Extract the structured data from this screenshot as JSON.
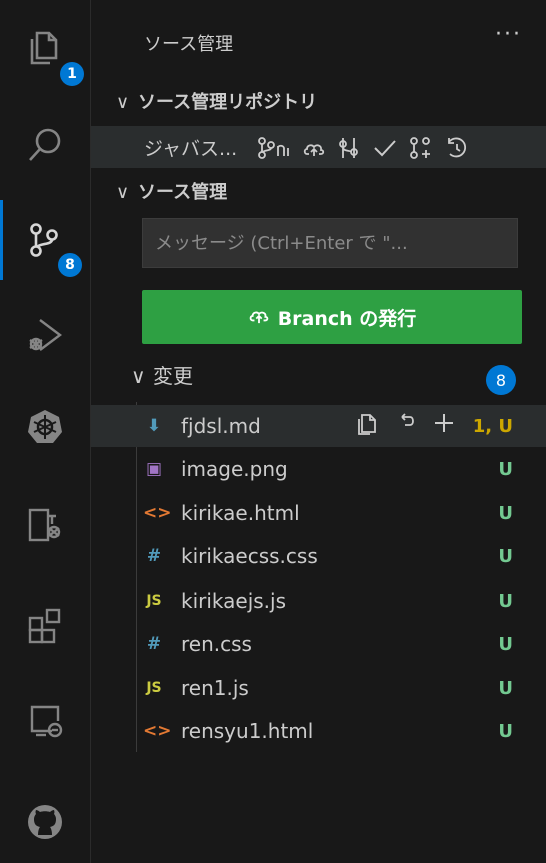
{
  "activity": {
    "explorer_badge": "1",
    "scm_badge": "8"
  },
  "sidebar": {
    "title": "ソース管理",
    "more": "···",
    "repos_header": "ソース管理リポジトリ",
    "repo_name": "ジャバス...",
    "scm_header": "ソース管理",
    "message_placeholder": "メッセージ (Ctrl+Enter で \"...",
    "publish_label": "Branch の発行",
    "changes_label": "変更",
    "changes_count": "8"
  },
  "files": [
    {
      "icon": "markdown-icon",
      "icon_glyph": "⬇",
      "icon_color": "#519aba",
      "name": "fjdsl.md",
      "status": "1, U",
      "status_color": "#cca700"
    },
    {
      "icon": "image-icon",
      "icon_glyph": "▣",
      "icon_color": "#a074c4",
      "name": "image.png",
      "status": "U",
      "status_color": "#73c991"
    },
    {
      "icon": "html-icon",
      "icon_glyph": "<>",
      "icon_color": "#e37933",
      "name": "kirikae.html",
      "status": "U",
      "status_color": "#73c991"
    },
    {
      "icon": "css-icon",
      "icon_glyph": "#",
      "icon_color": "#519aba",
      "name": "kirikaecss.css",
      "status": "U",
      "status_color": "#73c991"
    },
    {
      "icon": "js-icon",
      "icon_glyph": "JS",
      "icon_color": "#cbcb41",
      "name": "kirikaejs.js",
      "status": "U",
      "status_color": "#73c991"
    },
    {
      "icon": "css-icon",
      "icon_glyph": "#",
      "icon_color": "#519aba",
      "name": "ren.css",
      "status": "U",
      "status_color": "#73c991"
    },
    {
      "icon": "js-icon",
      "icon_glyph": "JS",
      "icon_color": "#cbcb41",
      "name": "ren1.js",
      "status": "U",
      "status_color": "#73c991"
    },
    {
      "icon": "html-icon",
      "icon_glyph": "<>",
      "icon_color": "#e37933",
      "name": "rensyu1.html",
      "status": "U",
      "status_color": "#73c991"
    }
  ],
  "colors": {
    "accent": "#0078d4",
    "publish": "#2ea043",
    "untracked": "#73c991",
    "modified": "#cca700"
  }
}
